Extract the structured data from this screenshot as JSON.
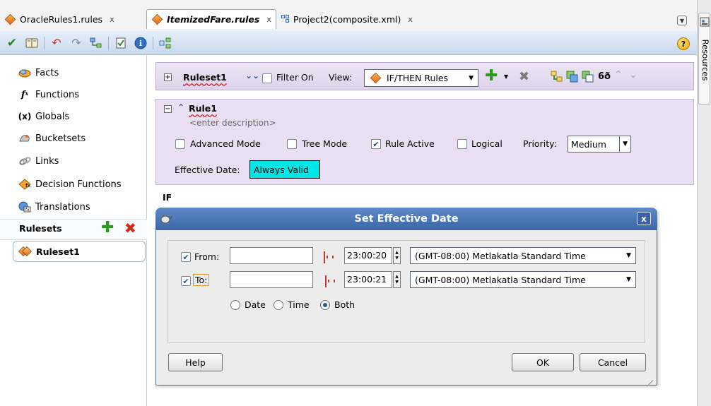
{
  "tabs": [
    {
      "label": "OracleRules1.rules",
      "close": "x"
    },
    {
      "label": "ItemizedFare.rules",
      "close": "x",
      "active": true
    },
    {
      "label": "Project2(composite.xml)",
      "close": "x"
    }
  ],
  "right_panel": {
    "label": "Resources"
  },
  "toolbar": {
    "help": "?"
  },
  "nav": {
    "items": [
      {
        "label": "Facts",
        "icon": "facts-icon"
      },
      {
        "label": "Functions",
        "icon": "function-icon"
      },
      {
        "label": "Globals",
        "icon": "globals-icon"
      },
      {
        "label": "Bucketsets",
        "icon": "bucketsets-icon"
      },
      {
        "label": "Links",
        "icon": "links-icon"
      },
      {
        "label": "Decision Functions",
        "icon": "decision-functions-icon"
      },
      {
        "label": "Translations",
        "icon": "translations-icon"
      }
    ],
    "rulesets_header": "Rulesets",
    "rulesets": [
      "Ruleset1"
    ]
  },
  "ruleset_bar": {
    "name": "Ruleset1",
    "filter_label": "Filter On",
    "view_label": "View:",
    "view_value": "IF/THEN Rules"
  },
  "rule": {
    "name": "Rule1",
    "description": "<enter description>",
    "advanced_mode": "Advanced Mode",
    "tree_mode": "Tree Mode",
    "rule_active": "Rule Active",
    "logical": "Logical",
    "priority_label": "Priority:",
    "priority_value": "Medium",
    "effective_date_label": "Effective Date:",
    "effective_date_value": "Always Valid",
    "if_label": "IF"
  },
  "dialog": {
    "title": "Set Effective Date",
    "close": "x",
    "from_label": "From:",
    "from_date": "",
    "from_time": "23:00:20",
    "from_tz": "(GMT-08:00) Metlakatla Standard Time",
    "to_label": "To:",
    "to_date": "",
    "to_time": "23:00:21",
    "to_tz": "(GMT-08:00) Metlakatla Standard Time",
    "radio_date": "Date",
    "radio_time": "Time",
    "radio_both": "Both",
    "selected": "Both",
    "help": "Help",
    "ok": "OK",
    "cancel": "Cancel"
  },
  "colors": {
    "accent": "#3b67aa",
    "effective_date_bg": "#00e5e5",
    "rule_panel_bg": "#eadff2"
  }
}
